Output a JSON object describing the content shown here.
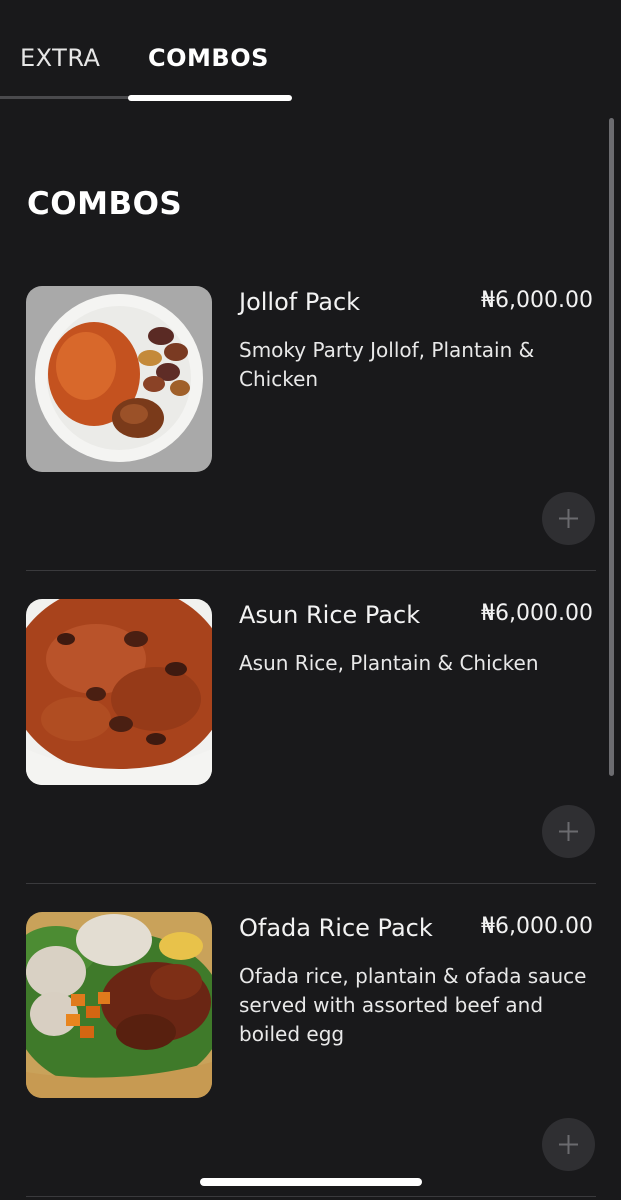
{
  "tabs": [
    {
      "label": "EXTRA",
      "active": false
    },
    {
      "label": "COMBOS",
      "active": true
    }
  ],
  "section": {
    "title": "COMBOS"
  },
  "items": [
    {
      "name": "Jollof Pack",
      "price": "₦6,000.00",
      "description": "Smoky Party Jollof, Plantain & Chicken",
      "image": "jollof-rice-plantain-chicken-plate"
    },
    {
      "name": "Asun Rice Pack",
      "price": "₦6,000.00",
      "description": "Asun Rice, Plantain & Chicken",
      "image": "asun-rice-bowl"
    },
    {
      "name": "Ofada Rice Pack",
      "price": "₦6,000.00",
      "description": "Ofada rice, plantain & ofada sauce served with assorted beef and boiled egg",
      "image": "ofada-rice-platter"
    }
  ],
  "icons": {
    "add": "plus-icon"
  },
  "colors": {
    "background": "#19191b",
    "button": "#2f2f32",
    "divider": "#3a3a3d",
    "text": "#ffffff"
  }
}
